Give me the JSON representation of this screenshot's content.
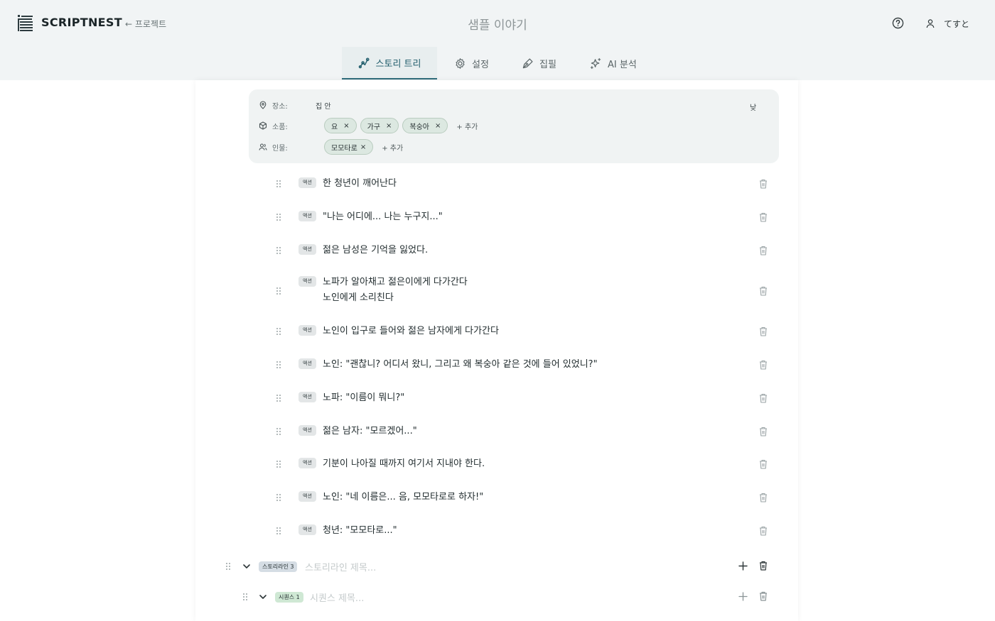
{
  "header": {
    "brand": "SCRIPTNEST",
    "back_label": "← 프로젝트",
    "project_title": "샘플 이야기",
    "user_name": "てすと"
  },
  "tabs": [
    {
      "label": "스토리 트리",
      "icon": "story-tree-icon",
      "active": true
    },
    {
      "label": "설정",
      "icon": "gear-icon",
      "active": false
    },
    {
      "label": "집필",
      "icon": "pen-icon",
      "active": false
    },
    {
      "label": "AI 분석",
      "icon": "sparkle-icon",
      "active": false
    }
  ],
  "scene": {
    "place_label": "장소:",
    "place_value": "집 안",
    "time_value": "낮",
    "props_label": "소품:",
    "props": [
      "요",
      "가구",
      "복숭아"
    ],
    "people_label": "인물:",
    "people": [
      "모모타로"
    ],
    "add_label": "+ 추가",
    "remove_glyph": "×"
  },
  "action_tag": "액션",
  "actions": [
    "한 청년이 깨어난다",
    "\"나는 어디에... 나는 누구지...\"",
    "젊은 남성은 기억을 잃었다.",
    "노파가 알아채고 젊은이에게 다가간다\n노인에게 소리친다",
    "노인이 입구로 들어와 젊은 남자에게 다가간다",
    "노인: \"괜찮니? 어디서 왔니, 그리고 왜 복숭아 같은 것에 들어 있었니?\"",
    "노파: \"이름이 뭐니?\"",
    "젊은 남자: \"모르겠어...\"",
    "기분이 나아질 때까지 여기서 지내야 한다.",
    "노인: \"네 이름은... 음, 모모타로로 하자!\"",
    "청년: \"모모타로...\""
  ],
  "storyline": {
    "badge": "스토리라인 3",
    "placeholder": "스토리라인 제목..."
  },
  "sequence": {
    "badge": "시퀀스 1",
    "placeholder": "시퀀스 제목..."
  },
  "colors": {
    "accent": "#2f6d7c",
    "chip_bg": "#dce8e1",
    "storyline_badge": "#d5dde4",
    "sequence_badge": "#cfe8d4"
  }
}
